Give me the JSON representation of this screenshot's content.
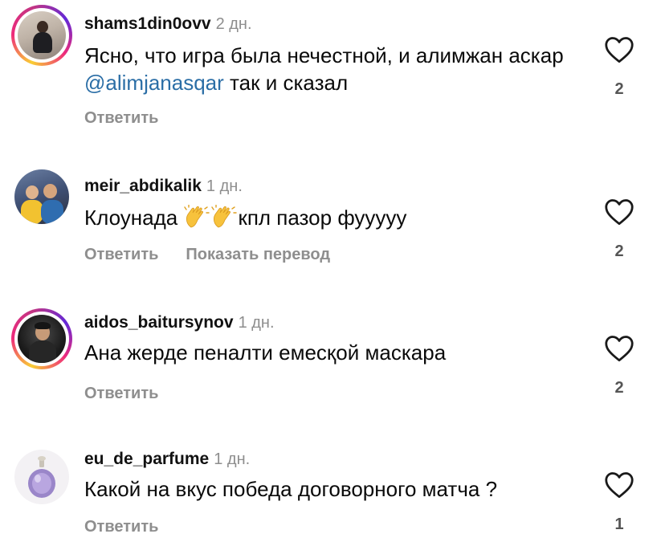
{
  "comments": [
    {
      "username": "shams1din0ovv",
      "time": "2 дн.",
      "text_before": "Ясно, что игра была нечестной, и алимжан аскар ",
      "mention": "@alimjanasqar",
      "text_after": " так и сказал",
      "reply_label": "Ответить",
      "likes": "2",
      "has_story_ring": true
    },
    {
      "username": "meir_abdikalik",
      "time": "1 дн.",
      "text_before": "Клоунада ",
      "emoji": "clapping-hands",
      "text_after": "кпл пазор фууууу",
      "reply_label": "Ответить",
      "translate_label": "Показать перевод",
      "likes": "2",
      "has_story_ring": false
    },
    {
      "username": "aidos_baitursynov",
      "time": "1 дн.",
      "text": "Ана жерде пеналти емесқой маскара",
      "reply_label": "Ответить",
      "likes": "2",
      "has_story_ring": true
    },
    {
      "username": "eu_de_parfume",
      "time": "1 дн.",
      "text": "Какой на вкус победа договорного матча ?",
      "reply_label": "Ответить",
      "likes": "1",
      "has_story_ring": false
    }
  ],
  "icons": {
    "like": "heart-outline-icon",
    "emoji": "clapping-hands-emoji"
  },
  "colors": {
    "mention": "#2b6ea6",
    "muted": "#8e8e8e",
    "story_ring_start": "#f9ce34",
    "story_ring_end": "#ee2a7b"
  }
}
